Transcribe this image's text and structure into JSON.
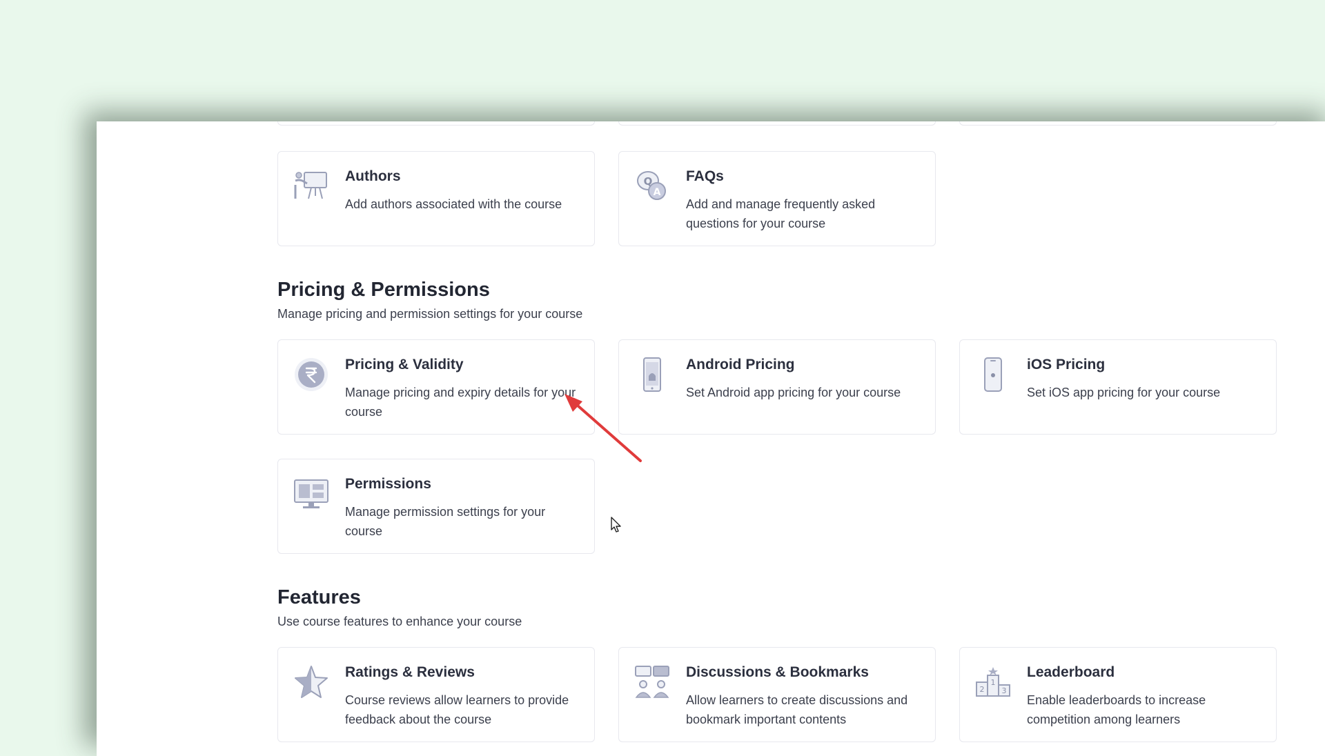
{
  "sections": {
    "pricing": {
      "title": "Pricing & Permissions",
      "subtitle": "Manage pricing and permission settings for your course"
    },
    "features": {
      "title": "Features",
      "subtitle": "Use course features to enhance your course"
    }
  },
  "cards": {
    "authors": {
      "title": "Authors",
      "desc": "Add authors associated with the course",
      "icon": "presenter-icon"
    },
    "faqs": {
      "title": "FAQs",
      "desc": "Add and manage frequently asked questions for your course",
      "icon": "faq-icon"
    },
    "pricing_validity": {
      "title": "Pricing & Validity",
      "desc": "Manage pricing and expiry details for your course",
      "icon": "rupee-icon"
    },
    "android_pricing": {
      "title": "Android Pricing",
      "desc": "Set Android app pricing for your course",
      "icon": "android-phone-icon"
    },
    "ios_pricing": {
      "title": "iOS Pricing",
      "desc": "Set iOS app pricing for your course",
      "icon": "iphone-icon"
    },
    "permissions": {
      "title": "Permissions",
      "desc": "Manage permission settings for your course",
      "icon": "monitor-icon"
    },
    "ratings_reviews": {
      "title": "Ratings & Reviews",
      "desc": "Course reviews allow learners to provide feedback about the course",
      "icon": "star-icon"
    },
    "discussions_bookmarks": {
      "title": "Discussions & Bookmarks",
      "desc": "Allow learners to create discussions and bookmark important contents",
      "icon": "discussion-icon"
    },
    "leaderboard": {
      "title": "Leaderboard",
      "desc": "Enable leaderboards to increase competition among learners",
      "icon": "podium-icon"
    }
  },
  "annotation": {
    "arrow_color": "#e03b3b"
  },
  "colors": {
    "background": "#e9f8ec",
    "icon": "#9aa0b8",
    "text": "#2b2f3e"
  }
}
